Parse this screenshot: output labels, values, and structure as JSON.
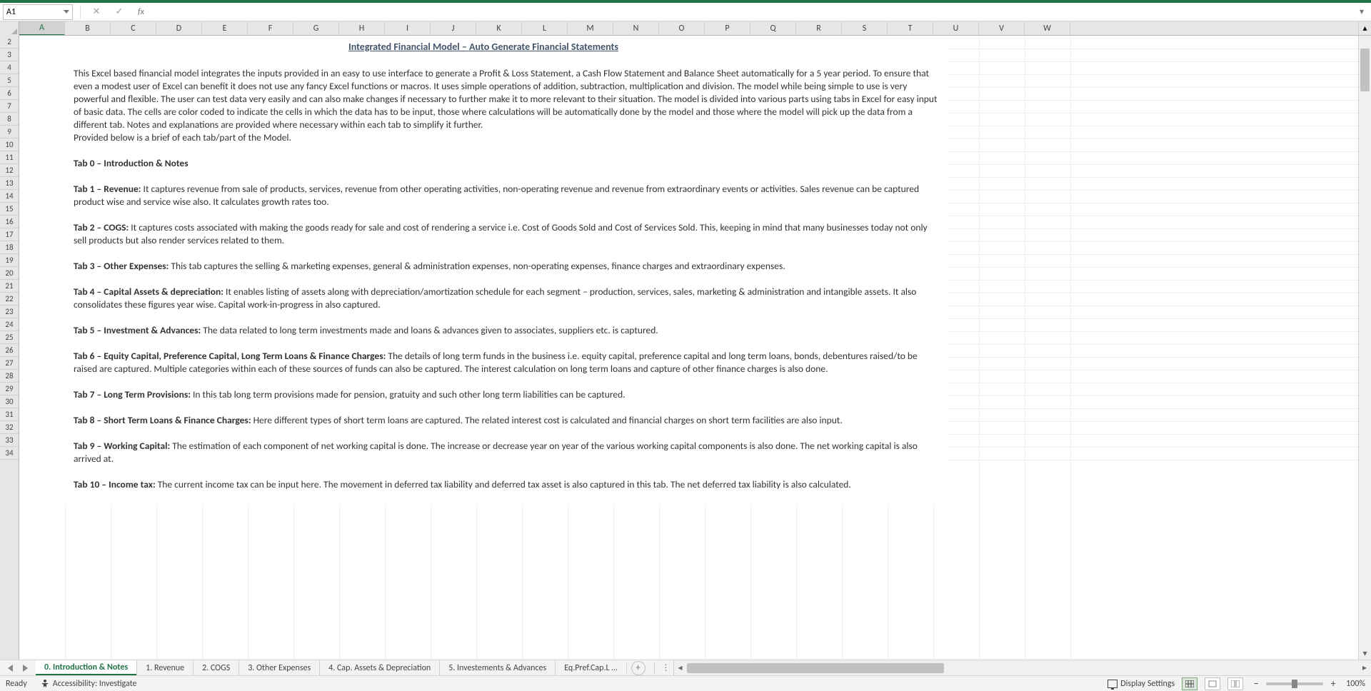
{
  "nameBox": {
    "value": "A1"
  },
  "formulaBar": {
    "fx_label": "fx",
    "cancel_glyph": "✕",
    "accept_glyph": "✓",
    "value": "",
    "expand_glyph": "▾"
  },
  "columns": [
    "A",
    "B",
    "C",
    "D",
    "E",
    "F",
    "G",
    "H",
    "I",
    "J",
    "K",
    "L",
    "M",
    "N",
    "O",
    "P",
    "Q",
    "R",
    "S",
    "T",
    "U",
    "V",
    "W"
  ],
  "selectedColumn": "A",
  "rowStart": 2,
  "rowEnd": 34,
  "doc": {
    "title": "Integrated Financial Model – Auto Generate Financial Statements",
    "intro": "This Excel based financial model integrates the inputs provided in an easy to use interface to generate a Profit & Loss Statement, a Cash Flow Statement and   Balance Sheet automatically for a 5 year period. To ensure that even a modest user of Excel can benefit it does not use any fancy Excel functions or macros. It uses simple operations of addition, subtraction, multiplication and division. The model while being simple to use is very powerful and flexible. The user can test data very easily and can also make changes if necessary to further make it to more relevant to their situation. The model is divided into various parts using tabs in Excel for easy input of basic data. The cells are color coded to indicate the cells in which the data has to be input, those where calculations will be automatically done by the model and those where the model will pick up the data from a different tab. Notes and explanations are provided where necessary within each tab to simplify it further.",
    "intro_trailer": "Provided below is a brief of each tab/part of the Model.",
    "tabs": [
      {
        "label": "Tab 0 – Introduction & Notes",
        "text": ""
      },
      {
        "label": "Tab 1 – Revenue:",
        "text": "  It captures revenue from sale of products, services, revenue from other operating activities, non-operating revenue and revenue from extraordinary events or activities. Sales revenue can be captured product wise and service wise also. It calculates growth rates too."
      },
      {
        "label": "Tab 2 – COGS:",
        "text": " It captures costs associated with making the goods ready for sale and cost of rendering a service i.e. Cost of Goods Sold and Cost of Services Sold. This, keeping in mind that many businesses today not only sell products but also render services related to them."
      },
      {
        "label": "Tab 3 – Other Expenses:",
        "text": " This tab captures the selling & marketing expenses, general & administration expenses, non-operating expenses, finance charges and extraordinary expenses."
      },
      {
        "label": "Tab 4 – Capital Assets & depreciation:",
        "text": " It enables listing of assets along with depreciation/amortization schedule for each segment – production, services, sales, marketing & administration and intangible assets. It also consolidates these figures year wise. Capital work-in-progress in also captured."
      },
      {
        "label": "Tab 5 – Investment & Advances:",
        "text": " The data related to long term investments made and loans & advances given to associates, suppliers etc. is captured."
      },
      {
        "label": "Tab 6 – Equity Capital, Preference Capital, Long Term Loans & Finance Charges:",
        "text": " The details of long term funds in the business i.e.  equity capital, preference capital and long term loans, bonds, debentures raised/to be raised are captured.  Multiple categories within each of these sources of funds can also be captured. The interest calculation on long term loans and capture of other finance charges is also done."
      },
      {
        "label": "Tab 7 – Long Term Provisions:",
        "text": " In this tab long term provisions made for pension, gratuity and such other long term liabilities can be captured."
      },
      {
        "label": "Tab 8 – Short Term Loans & Finance Charges:",
        "text": " Here different types of short term loans are captured. The related interest cost is calculated and financial charges on short term facilities are also input."
      },
      {
        "label": "Tab 9 – Working Capital:",
        "text": " The estimation of each component of net working capital is done. The increase or decrease year on year of the various working capital components is also done. The net working capital is also arrived at."
      },
      {
        "label": "Tab 10 – Income tax:",
        "text": " The current income tax can be input here. The movement in deferred tax liability and deferred tax asset is also captured in this tab. The net deferred tax liability is also calculated."
      }
    ]
  },
  "sheetTabs": {
    "active": "0. Introduction & Notes",
    "list": [
      "0. Introduction & Notes",
      "1. Revenue",
      "2. COGS",
      "3. Other Expenses",
      "4. Cap. Assets & Depreciation",
      "5. Investements & Advances"
    ],
    "overflow": "Eq.Pref.Cap.L …",
    "add_glyph": "+",
    "more_glyph": "⋮"
  },
  "status": {
    "ready": "Ready",
    "accessibility": "Accessibility: Investigate",
    "display": "Display Settings",
    "zoom": "100%",
    "minus": "−",
    "plus": "+"
  },
  "scroll": {
    "up": "▴",
    "down": "▾",
    "left": "◂",
    "right": "▸"
  }
}
